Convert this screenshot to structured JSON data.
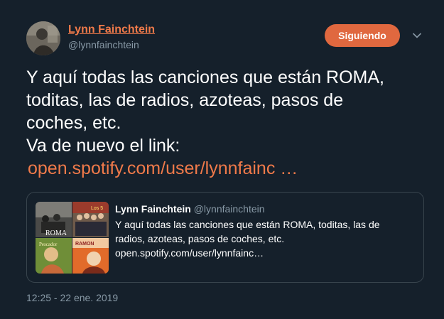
{
  "author": {
    "name": "Lynn Fainchtein",
    "handle": "@lynnfainchtein"
  },
  "follow_button": {
    "label": "Siguiendo"
  },
  "tweet": {
    "lines": [
      "Y aquí todas las canciones que están ROMA,",
      "toditas, las de radios, azoteas, pasos de",
      "coches, etc.",
      "Va de nuevo el link:"
    ],
    "link_text": "open.spotify.com/user/lynnfainc  …"
  },
  "quoted_tweet": {
    "name": "Lynn Fainchtein",
    "handle": "@lynnfainchtein",
    "lines": [
      "Y aquí todas las canciones que están ROMA, toditas, las de",
      "radios, azoteas, pasos de coches, etc.",
      "open.spotify.com/user/lynnfainc…"
    ],
    "thumbnails": {
      "roma_title": "ROMA",
      "label_2": "Los 5",
      "label_3": "Pescador",
      "label_4": "RAMON"
    }
  },
  "timestamp": "12:25 - 22 ene. 2019",
  "colors": {
    "background": "#15202b",
    "accent": "#f07a4a",
    "button": "#e0683f",
    "muted": "#8899a6",
    "border": "#38444d"
  }
}
